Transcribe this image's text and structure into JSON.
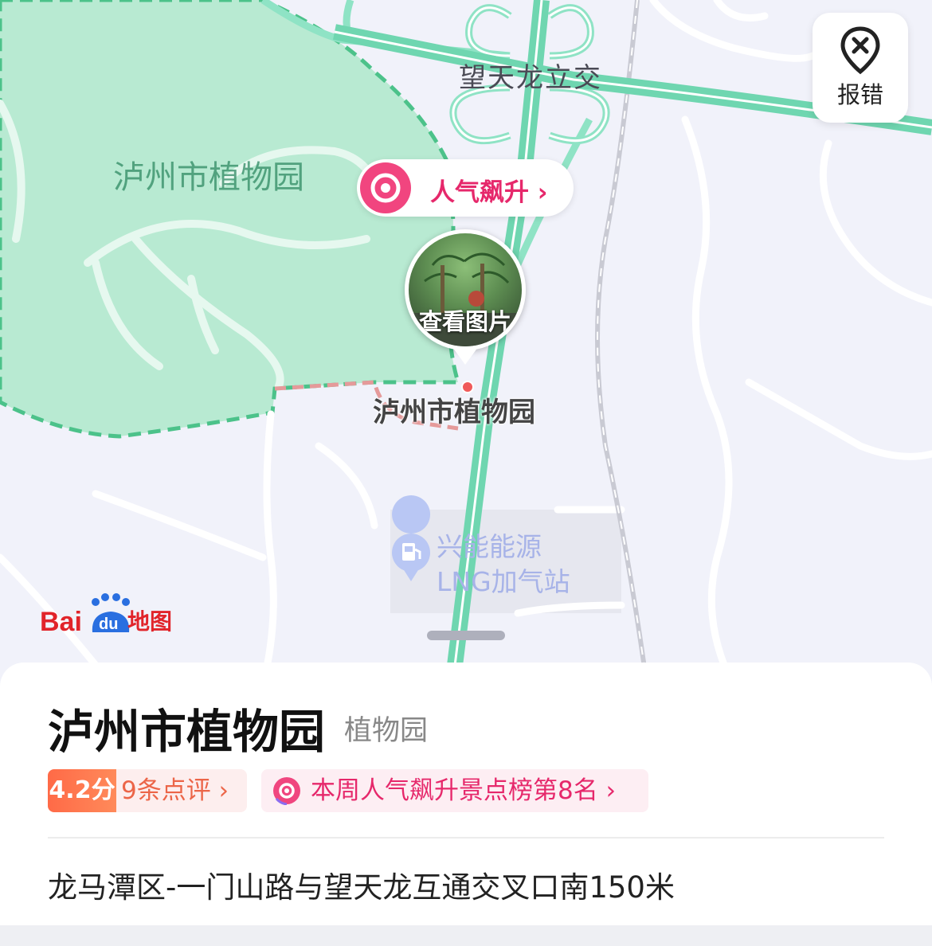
{
  "map": {
    "park_area_label": "泸州市植物园",
    "interchange_label": "望天龙立交",
    "poi_map_label": "泸州市植物园",
    "gas_station_label_line1": "兴能能源",
    "gas_station_label_line2": "LNG加气站",
    "popular_tag_text": "人气飙升 ›",
    "photo_bubble_text": "查看图片",
    "report_button_label": "报错",
    "logo_alt": "Baidu地图",
    "colors": {
      "park_fill": "#b8ead2",
      "park_border": "#4cc28a",
      "road": "#8fe3c5",
      "highway": "#6fd6b0",
      "background": "#f1f2fa",
      "accent_pink": "#e6286b",
      "baidu_red": "#e1242a",
      "baidu_blue": "#2a6fe0"
    }
  },
  "panel": {
    "title": "泸州市植物园",
    "category": "植物园",
    "rating_score": "4.2分",
    "rating_reviews": "9条点评 ›",
    "rank_text": "本周人气飙升景点榜第8名 ›",
    "address": "龙马潭区-一门山路与望天龙互通交叉口南150米"
  }
}
